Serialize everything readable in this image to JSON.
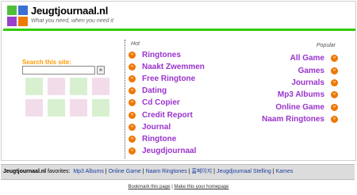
{
  "colors": {
    "accent_green": "#33cc00",
    "link_purple": "#9933cc",
    "search_label_orange": "#ff9900",
    "bullet_orange": "#ee7700",
    "logo_squares": [
      "#4fbf38",
      "#3c6fd6",
      "#9a3fce",
      "#ee7a00"
    ],
    "thumb_colors": [
      "#d8f0d0",
      "#f3dcea",
      "#d8f0d0",
      "#f3dcea",
      "#f3dcea",
      "#d8f0d0",
      "#f3dcea",
      "#d8f0d0"
    ]
  },
  "header": {
    "site_title": "Jeugtjournaal.nl",
    "tagline": "What you need, when you need it",
    "logo_icon": "four-squares-logo"
  },
  "search": {
    "label": "Search this site:",
    "input_value": "",
    "button_label": "»"
  },
  "hot": {
    "header": "Hot",
    "bullet_glyph": "»",
    "items": [
      "Ringtones",
      "Naakt Zwemmen",
      "Free Ringtone",
      "Dating",
      "Cd Copier",
      "Credit Report",
      "Journal",
      "Ringtone",
      "Jeugdjournaal"
    ]
  },
  "popular": {
    "header": "Popular",
    "bullet_glyph": "»",
    "items": [
      "All Game",
      "Games",
      "Journals",
      "Mp3 Albums",
      "Online Game",
      "Naam Ringtones"
    ]
  },
  "favorites": {
    "site": "Jeugtjournaal.nl",
    "label": " favorites:",
    "separator": "|",
    "links": [
      "Mp3 Albums",
      "Online Game",
      "Naam Ringtones",
      "홈페이지",
      "Jeugdjournaal Stelling",
      "Kames"
    ]
  },
  "footer": {
    "bookmark_label": "Bookmark this page",
    "separator": "|",
    "homepage_label": "Make this your homepage"
  }
}
